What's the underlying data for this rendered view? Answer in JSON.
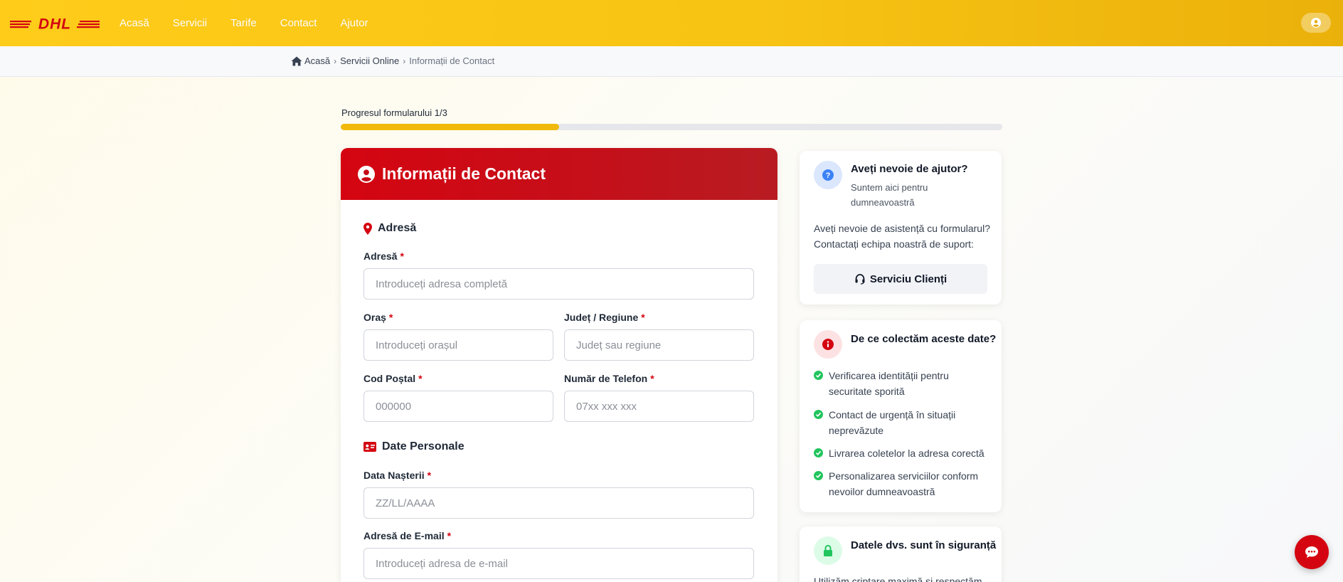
{
  "header": {
    "brand": "DHL",
    "nav": [
      "Acasă",
      "Servicii",
      "Tarife",
      "Contact",
      "Ajutor"
    ]
  },
  "breadcrumb": {
    "home": "Acasă",
    "section": "Servicii Online",
    "current": "Informații de Contact"
  },
  "progress": {
    "label": "Progresul formularului 1/3",
    "fraction": 0.33
  },
  "form": {
    "title": "Informații de Contact",
    "required_mark": "*",
    "address_section": "Adresă",
    "fields": {
      "address": {
        "label": "Adresă",
        "placeholder": "Introduceți adresa completă"
      },
      "city": {
        "label": "Oraș",
        "placeholder": "Introduceți orașul"
      },
      "county": {
        "label": "Județ / Regiune",
        "placeholder": "Județ sau regiune"
      },
      "postal": {
        "label": "Cod Poștal",
        "placeholder": "000000"
      },
      "phone": {
        "label": "Număr de Telefon",
        "placeholder": "07xx xxx xxx"
      },
      "dob": {
        "label": "Data Nașterii",
        "placeholder": "ZZ/LL/AAAA"
      },
      "email": {
        "label": "Adresă de E-mail",
        "placeholder": "Introduceți adresa de e-mail"
      }
    },
    "personal_section": "Date Personale"
  },
  "help_card": {
    "title": "Aveți nevoie de ajutor?",
    "subtitle": "Suntem aici pentru dumneavoastră",
    "text": "Aveți nevoie de asistență cu formularul? Contactați echipa noastră de suport:",
    "button": "Serviciu Clienți"
  },
  "why_card": {
    "title": "De ce colectăm aceste date?",
    "items": [
      "Verificarea identității pentru securitate sporită",
      "Contact de urgență în situații neprevăzute",
      "Livrarea coletelor la adresa corectă",
      "Personalizarea serviciilor conform nevoilor dumneavoastră"
    ]
  },
  "safe_card": {
    "title": "Datele dvs. sunt în siguranță",
    "text": "Utilizăm criptare maximă și respectăm"
  },
  "colors": {
    "yellow": "#ffcc00",
    "red": "#d40511",
    "green": "#22c55e",
    "blue": "#3b82f6"
  }
}
